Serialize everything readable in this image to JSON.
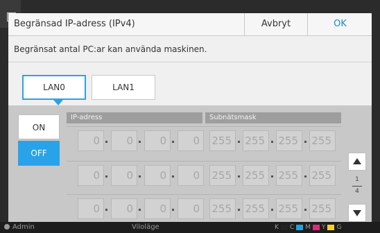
{
  "status_bar": {
    "user": "Admin",
    "mode": "Viloläge",
    "inks": [
      {
        "label": "K",
        "color": "#222222"
      },
      {
        "label": "C",
        "color": "#1aa3e8"
      },
      {
        "label": "M",
        "color": "#e0297a"
      },
      {
        "label": "Y",
        "color": "#f2d51a"
      },
      {
        "label": "G",
        "color": "#888888"
      }
    ]
  },
  "dialog": {
    "title": "Begränsad IP-adress (IPv4)",
    "cancel_label": "Avbryt",
    "ok_label": "OK",
    "description": "Begränsat antal PC:ar kan använda maskinen.",
    "tabs": [
      {
        "label": "LAN0",
        "active": true
      },
      {
        "label": "LAN1",
        "active": false
      }
    ],
    "toggle": {
      "on_label": "ON",
      "off_label": "OFF",
      "selected": "OFF"
    },
    "headers": {
      "ip": "IP-adress",
      "mask": "Subnätsmask"
    },
    "rows": [
      {
        "ip": [
          "0",
          "0",
          "0",
          "0"
        ],
        "mask": [
          "255",
          "255",
          "255",
          "255"
        ]
      },
      {
        "ip": [
          "0",
          "0",
          "0",
          "0"
        ],
        "mask": [
          "255",
          "255",
          "255",
          "255"
        ]
      },
      {
        "ip": [
          "0",
          "0",
          "0",
          "0"
        ],
        "mask": [
          "255",
          "255",
          "255",
          "255"
        ]
      }
    ],
    "pager": {
      "current": "1",
      "total": "4"
    }
  },
  "colors": {
    "accent": "#29a3e8",
    "ok_text": "#1a8ad6"
  }
}
